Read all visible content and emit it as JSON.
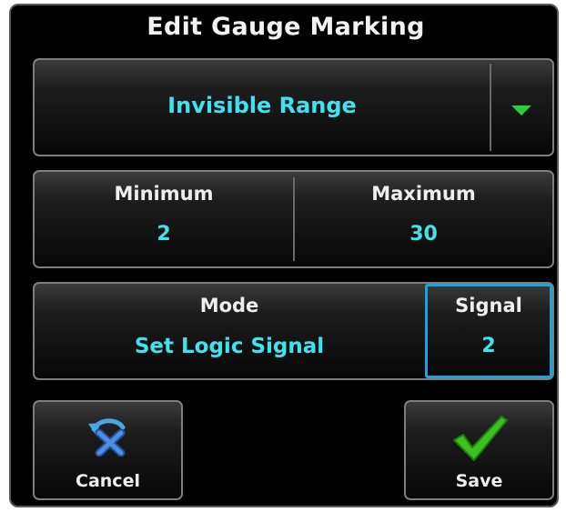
{
  "dialog": {
    "title": "Edit Gauge Marking"
  },
  "marking_type": {
    "value": "Invisible Range",
    "dropdown_icon": "chevron-down-icon"
  },
  "range": {
    "minimum_label": "Minimum",
    "minimum_value": "2",
    "maximum_label": "Maximum",
    "maximum_value": "30"
  },
  "mode": {
    "label": "Mode",
    "value": "Set Logic Signal"
  },
  "signal": {
    "label": "Signal",
    "value": "2"
  },
  "buttons": {
    "cancel_label": "Cancel",
    "save_label": "Save"
  },
  "colors": {
    "value_text": "#3fe3ef",
    "label_text": "#eeeeee",
    "selection_border": "#1aa3e0",
    "dropdown_arrow": "#28d13c",
    "save_check": "#3bc21f",
    "cancel_x": "#2a6cc2"
  }
}
